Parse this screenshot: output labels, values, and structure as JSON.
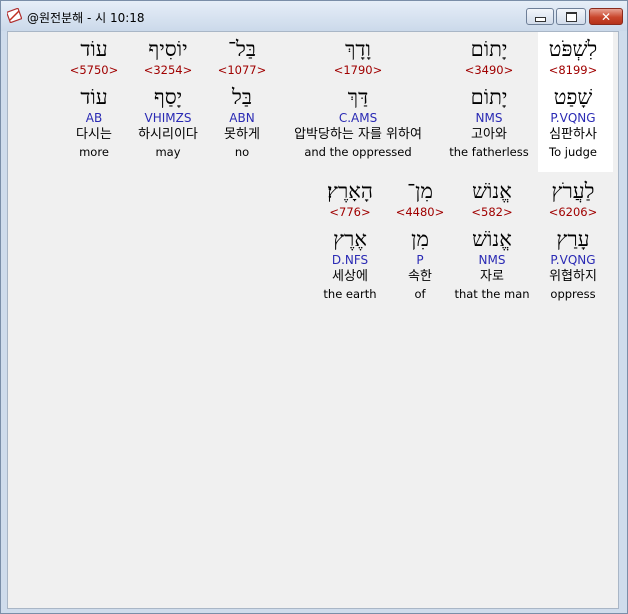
{
  "window": {
    "title": "@원전분해 - 시 10:18",
    "minimize_glyph": "",
    "maximize_glyph": "",
    "close_glyph": "✕"
  },
  "rows": [
    {
      "words": [
        {
          "hebrew": "עוֹד",
          "strong": "<5750>",
          "root": "עוֹד",
          "morph": "AB",
          "korean": "다시는",
          "english": "more"
        },
        {
          "hebrew": "יוֹסִיף",
          "strong": "<3254>",
          "root": "יָסַף",
          "morph": "VHIMZS",
          "korean": "하시리이다",
          "english": "may"
        },
        {
          "hebrew": "בַּל־",
          "strong": "<1077>",
          "root": "בַּל",
          "morph": "ABN",
          "korean": "못하게",
          "english": "no"
        },
        {
          "hebrew": "וָדָךְ",
          "strong": "<1790>",
          "root": "דַּךְ",
          "morph": "C.AMS",
          "korean": "압박당하는 자를 위하여",
          "english": "and the oppressed"
        },
        {
          "hebrew": "יָתוֹם",
          "strong": "<3490>",
          "root": "יָתוֹם",
          "morph": "NMS",
          "korean": "고아와",
          "english": "the fatherless"
        },
        {
          "hebrew": "לִשְׁפֹּט",
          "strong": "<8199>",
          "root": "שָׁפַט",
          "morph": "P.VQNG",
          "korean": "심판하사",
          "english": "To judge"
        }
      ]
    },
    {
      "words": [
        {
          "hebrew": "הָאָרֶץ׃",
          "strong": "<776>",
          "root": "אֶרֶץ",
          "morph": "D.NFS",
          "korean": "세상에",
          "english": "the earth"
        },
        {
          "hebrew": "מִן־",
          "strong": "<4480>",
          "root": "מִן",
          "morph": "P",
          "korean": "속한",
          "english": "of"
        },
        {
          "hebrew": "אֱנוֹשׁ",
          "strong": "<582>",
          "root": "אֱנוֹשׁ",
          "morph": "NMS",
          "korean": "자로",
          "english": "that the man"
        },
        {
          "hebrew": "לַעֲרֹץ",
          "strong": "<6206>",
          "root": "עָרַץ",
          "morph": "P.VQNG",
          "korean": "위협하지",
          "english": "oppress"
        }
      ]
    }
  ]
}
